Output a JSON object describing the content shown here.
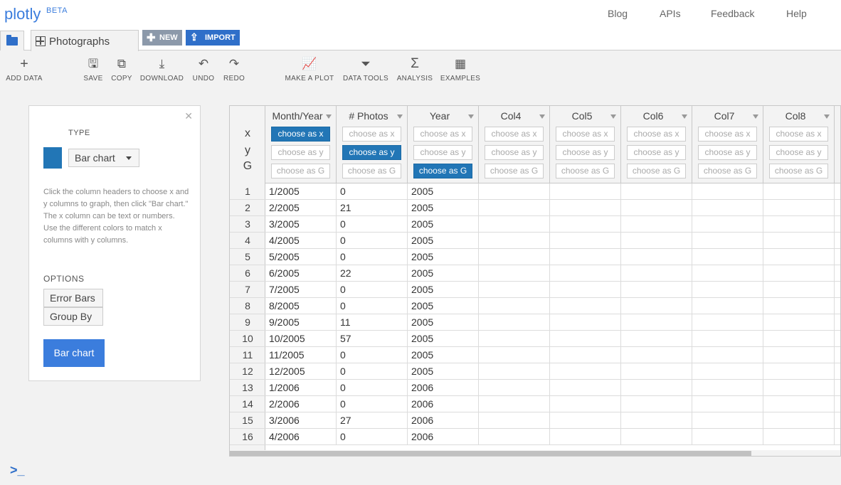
{
  "header": {
    "logo": "plotly",
    "badge": "BETA",
    "nav": [
      "Blog",
      "APIs",
      "Feedback",
      "Help"
    ]
  },
  "tabs": {
    "folder_icon": "folder-icon",
    "sheet_label": "Photographs",
    "new_label": "NEW",
    "import_label": "IMPORT"
  },
  "toolbar": {
    "add_data": "ADD DATA",
    "save": "SAVE",
    "copy": "COPY",
    "download": "DOWNLOAD",
    "undo": "UNDO",
    "redo": "REDO",
    "make_plot": "MAKE A PLOT",
    "data_tools": "DATA TOOLS",
    "analysis": "ANALYSIS",
    "examples": "EXAMPLES"
  },
  "panel": {
    "type_label": "TYPE",
    "chart_type": "Bar chart",
    "swatch_color": "#2276b6",
    "instructions": "Click the column headers to choose x and y columns to graph, then click \"Bar chart.\" The x column can be text or numbers. Use the different colors to match x columns with y columns.",
    "options_label": "OPTIONS",
    "error_bars": "Error Bars",
    "group_by": "Group By",
    "primary_button": "Bar chart"
  },
  "grid": {
    "axis_letters": [
      "x",
      "y",
      "G"
    ],
    "choose_x": "choose as x",
    "choose_y": "choose as y",
    "choose_g": "choose as G",
    "columns": [
      "Month/Year",
      "# Photos",
      "Year",
      "Col4",
      "Col5",
      "Col6",
      "Col7",
      "Col8"
    ],
    "rows": [
      {
        "n": "1",
        "c": [
          "1/2005",
          "0",
          "2005"
        ]
      },
      {
        "n": "2",
        "c": [
          "2/2005",
          "21",
          "2005"
        ]
      },
      {
        "n": "3",
        "c": [
          "3/2005",
          "0",
          "2005"
        ]
      },
      {
        "n": "4",
        "c": [
          "4/2005",
          "0",
          "2005"
        ]
      },
      {
        "n": "5",
        "c": [
          "5/2005",
          "0",
          "2005"
        ]
      },
      {
        "n": "6",
        "c": [
          "6/2005",
          "22",
          "2005"
        ]
      },
      {
        "n": "7",
        "c": [
          "7/2005",
          "0",
          "2005"
        ]
      },
      {
        "n": "8",
        "c": [
          "8/2005",
          "0",
          "2005"
        ]
      },
      {
        "n": "9",
        "c": [
          "9/2005",
          "11",
          "2005"
        ]
      },
      {
        "n": "10",
        "c": [
          "10/2005",
          "57",
          "2005"
        ]
      },
      {
        "n": "11",
        "c": [
          "11/2005",
          "0",
          "2005"
        ]
      },
      {
        "n": "12",
        "c": [
          "12/2005",
          "0",
          "2005"
        ]
      },
      {
        "n": "13",
        "c": [
          "1/2006",
          "0",
          "2006"
        ]
      },
      {
        "n": "14",
        "c": [
          "2/2006",
          "0",
          "2006"
        ]
      },
      {
        "n": "15",
        "c": [
          "3/2006",
          "27",
          "2006"
        ]
      },
      {
        "n": "16",
        "c": [
          "4/2006",
          "0",
          "2006"
        ]
      }
    ]
  },
  "colors": {
    "accent": "#3b7ddd",
    "selected": "#2276b6"
  }
}
